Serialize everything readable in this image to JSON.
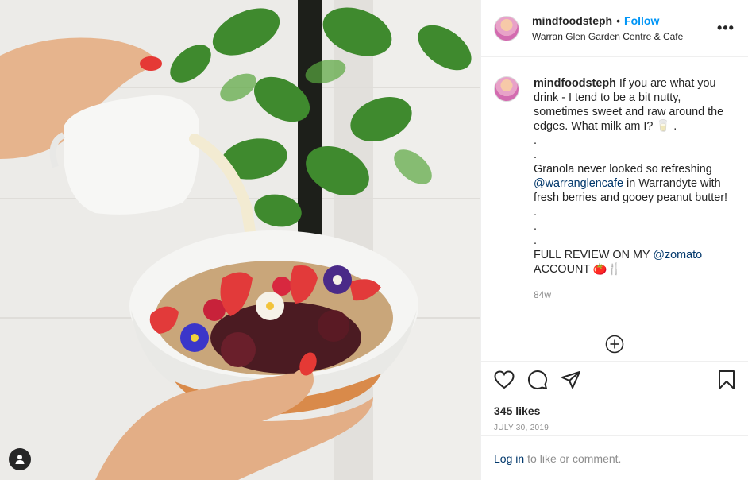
{
  "post": {
    "username": "mindfoodsteph",
    "follow_label": "Follow",
    "separator": "•",
    "location": "Warran Glen Garden Centre & Cafe",
    "more_label": "•••"
  },
  "caption": {
    "username": "mindfoodsteph",
    "text_1": "If you are what you drink - I tend to be a bit nutty, sometimes sweet and raw around the edges. What milk am I? 🥛 .",
    "dot_1": ".",
    "dot_2": ".",
    "text_2": "Granola never looked so refreshing",
    "mention_1": "@warranglencafe",
    "text_3": "in Warrandyte with fresh berries and gooey peanut butter!",
    "dot_3": ".",
    "dot_4": ".",
    "dot_5": ".",
    "text_4": "FULL REVIEW ON MY",
    "mention_2": "@zomato",
    "text_5": "ACCOUNT 🍅🍴",
    "time": "84w"
  },
  "engagement": {
    "likes": "345 likes",
    "date": "JULY 30, 2019"
  },
  "login": {
    "link": "Log in",
    "text": "to like or comment."
  },
  "icons": {
    "like": "heart-icon",
    "comment": "comment-icon",
    "share": "share-icon",
    "save": "bookmark-icon",
    "load_more": "plus-circle-icon",
    "user_tag": "user-tag-icon"
  }
}
